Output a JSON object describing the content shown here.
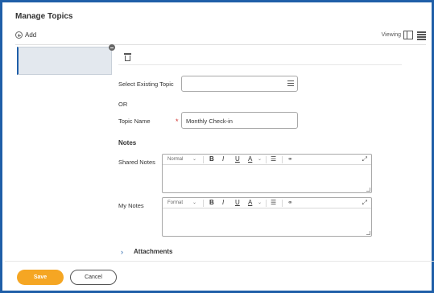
{
  "header": {
    "title": "Manage Topics",
    "add_label": "Add",
    "viewing_label": "Viewing"
  },
  "form": {
    "select_existing_label": "Select Existing Topic",
    "select_existing_value": "",
    "or_label": "OR",
    "topic_name_label": "Topic Name",
    "required_marker": "*",
    "topic_name_value": "Monthly Check-in",
    "notes_heading": "Notes",
    "shared_notes_label": "Shared Notes",
    "my_notes_label": "My Notes",
    "shared_editor_format": "Normal",
    "my_editor_format": "Format",
    "toolbar": {
      "bold": "B",
      "italic": "I",
      "underline": "U",
      "font_color": "A"
    },
    "shared_notes_value": "",
    "my_notes_value": "",
    "attachments_label": "Attachments"
  },
  "footer": {
    "save_label": "Save",
    "cancel_label": "Cancel"
  },
  "colors": {
    "frame_border": "#1f5fa8",
    "save_button": "#f5a623",
    "required": "#d0312d",
    "tile_bg": "#e3e8ee"
  },
  "icons": [
    "add-icon",
    "grid-view-icon",
    "list-view-icon",
    "remove-icon",
    "trash-icon",
    "list-select-icon",
    "chevron-down-icon",
    "bulleted-list-icon",
    "link-icon",
    "expand-icon",
    "chevron-right-icon"
  ]
}
